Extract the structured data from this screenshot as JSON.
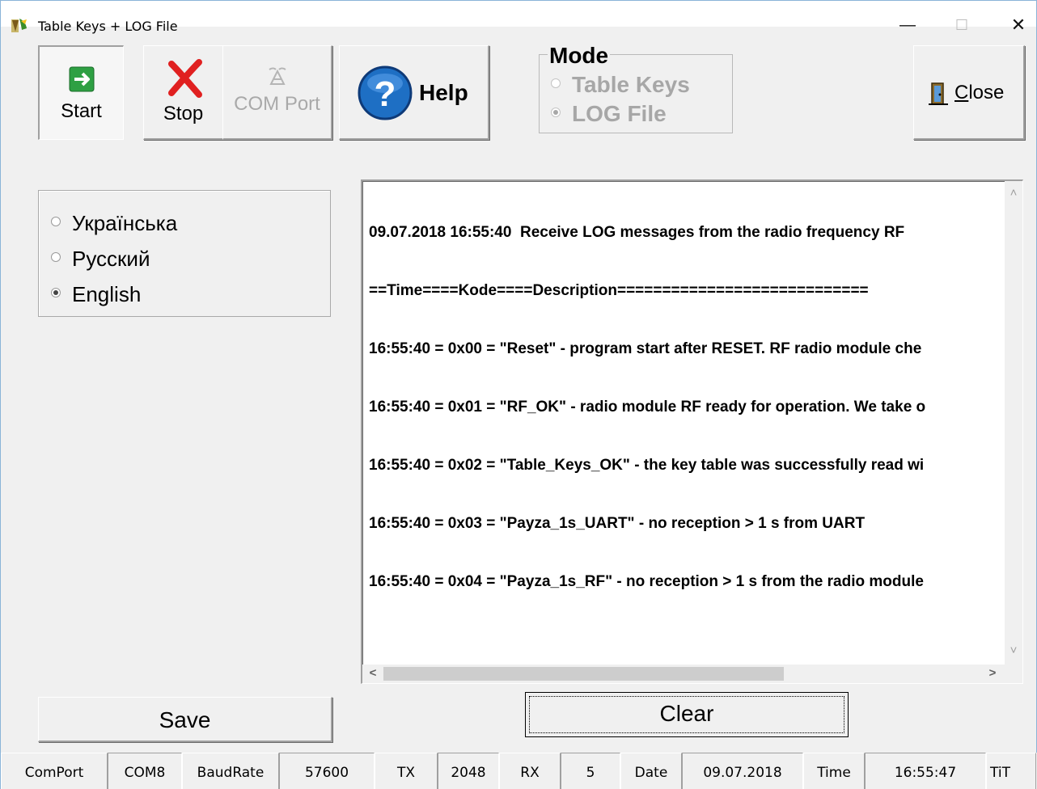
{
  "window": {
    "title": "Table Keys + LOG File",
    "minimize": "—",
    "maximize": "☐",
    "close": "✕"
  },
  "toolbar": {
    "start_label": "Start",
    "stop_label": "Stop",
    "com_port_label": "COM Port",
    "help_label": "Help",
    "close_label": "Close",
    "close_mnemonic": "C",
    "close_rest": "lose"
  },
  "mode": {
    "title": "Mode",
    "options": [
      {
        "label": "Table Keys",
        "selected": false,
        "enabled": false
      },
      {
        "label": "LOG File",
        "selected": true,
        "enabled": false
      }
    ]
  },
  "language": {
    "options": [
      {
        "label": "Українська",
        "selected": false
      },
      {
        "label": "Русский",
        "selected": false
      },
      {
        "label": "English",
        "selected": true
      }
    ]
  },
  "log": {
    "lines": [
      "09.07.2018 16:55:40  Receive LOG messages from the radio frequency RF",
      "==Time====Kode====Description============================",
      "16:55:40 = 0x00 = \"Reset\" - program start after RESET. RF radio module che",
      "16:55:40 = 0x01 = \"RF_OK\" - radio module RF ready for operation. We take o",
      "16:55:40 = 0x02 = \"Table_Keys_OK\" - the key table was successfully read wi",
      "16:55:40 = 0x03 = \"Payza_1s_UART\" - no reception > 1 s from UART",
      "16:55:40 = 0x04 = \"Payza_1s_RF\" - no reception > 1 s from the radio module"
    ],
    "scroll_up": "˄",
    "scroll_down": "˅",
    "scroll_left": "<",
    "scroll_right": ">"
  },
  "actions": {
    "save_label": "Save",
    "clear_label": "Clear"
  },
  "status": {
    "comport_label": "ComPort",
    "comport_value": "COM8",
    "baudrate_label": "BaudRate",
    "baudrate_value": "57600",
    "tx_label": "TX",
    "tx_value": "2048",
    "rx_label": "RX",
    "rx_value": "5",
    "date_label": "Date",
    "date_value": "09.07.2018",
    "time_label": "Time",
    "time_value": "16:55:47",
    "extra_label": "TiT"
  },
  "icons": {
    "start": "arrow-right-icon",
    "stop": "red-x-icon",
    "com_port": "com-port-icon",
    "help": "help-icon",
    "close": "door-exit-icon"
  },
  "colors": {
    "help_blue": "#1e6fc4",
    "start_green": "#2ea043",
    "stop_red": "#e02020"
  }
}
